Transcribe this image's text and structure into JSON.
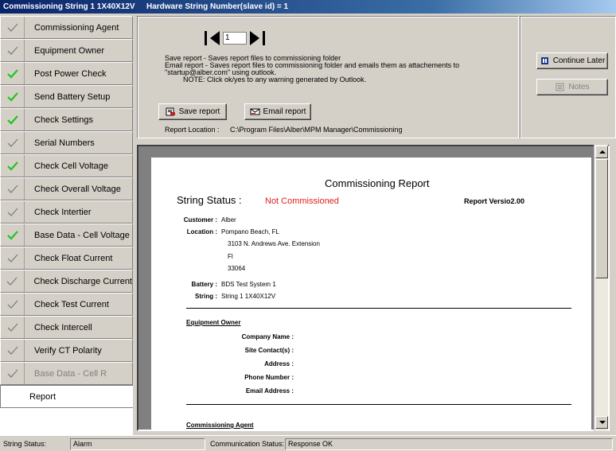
{
  "window": {
    "title": "Commissioning String 1 1X40X12V",
    "hardware": "Hardware String Number(slave id) = 1"
  },
  "sidebar": {
    "items": [
      {
        "label": "Commissioning Agent",
        "check": "gray"
      },
      {
        "label": "Equipment Owner",
        "check": "gray"
      },
      {
        "label": "Post Power Check",
        "check": "green"
      },
      {
        "label": "Send Battery Setup",
        "check": "green"
      },
      {
        "label": "Check Settings",
        "check": "green"
      },
      {
        "label": "Serial Numbers",
        "check": "gray"
      },
      {
        "label": "Check Cell Voltage",
        "check": "green"
      },
      {
        "label": "Check Overall Voltage",
        "check": "gray"
      },
      {
        "label": "Check Intertier",
        "check": "gray"
      },
      {
        "label": "Base Data - Cell Voltage",
        "check": "green"
      },
      {
        "label": "Check Float Current",
        "check": "gray"
      },
      {
        "label": "Check Discharge Current",
        "check": "gray"
      },
      {
        "label": "Check Test Current",
        "check": "gray"
      },
      {
        "label": "Check Intercell",
        "check": "gray"
      },
      {
        "label": "Verify CT Polarity",
        "check": "gray"
      },
      {
        "label": "Base Data - Cell R",
        "check": "gray",
        "disabled": true
      }
    ],
    "report_label": "Report",
    "check_colors": {
      "green": "#22c422",
      "gray": "#808080"
    }
  },
  "top": {
    "page_number": "1",
    "desc": {
      "line1": "Save report - Saves report files to commissioning folder",
      "line2": "Email report - Saves report files to commissioning folder and emails them as attachements to",
      "line3": "\"startup@alber.com\" using outlook.",
      "line4": "NOTE: Click ok/yes to any warning generated by Outlook."
    },
    "save_label": "Save report",
    "email_label": "Email report",
    "location_label": "Report Location :",
    "location_path": "C:\\Program Files\\Alber\\MPM Manager\\Commissioning"
  },
  "right": {
    "continue_label": "Continue Later",
    "notes_label": "Notes"
  },
  "report": {
    "title": "Commissioning Report",
    "string_status_label": "String Status :",
    "string_status_value": "Not Commissioned",
    "version": "Report Versio2.00",
    "customer_label": "Customer :",
    "customer": "Alber",
    "location_label": "Location :",
    "location_lines": [
      "Pompano Beach, FL",
      "3103 N. Andrews Ave. Extension",
      "Fl",
      "33064"
    ],
    "battery_label": "Battery :",
    "battery": "BDS Test System 1",
    "string_label": "String :",
    "string": "String 1 1X40X12V",
    "equipment_owner": "Equipment Owner",
    "fields": [
      "Company Name :",
      "Site Contact(s) :",
      "Address :",
      "Phone Number :",
      "Email Address :"
    ],
    "commissioning_agent": "Commissioning Agent",
    "status_color": "#e02020"
  },
  "status": {
    "string_status_label": "String Status:",
    "string_status_value": "Alarm",
    "comm_label": "Communication Status:",
    "comm_value": "Response OK"
  }
}
